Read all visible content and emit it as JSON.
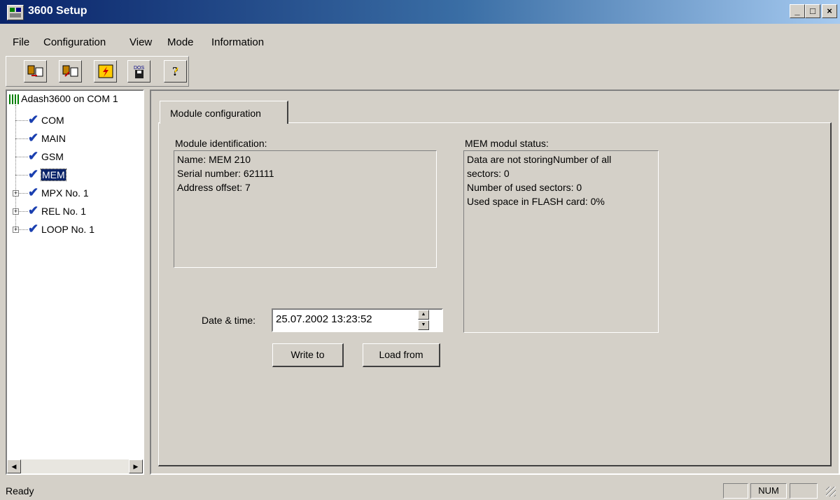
{
  "window": {
    "title": "3600 Setup",
    "min": "_",
    "max": "□",
    "close": "×"
  },
  "menu": [
    "File",
    "Configuration",
    "View",
    "Mode",
    "Information"
  ],
  "toolbar": [
    "connect-icon",
    "disconnect-icon",
    "flash-icon",
    "dos-disk-icon",
    "help-icon"
  ],
  "toolbar_dos_text": "DOS",
  "tree": {
    "root": "Adash3600 on COM 1",
    "items": [
      "COM",
      "MAIN",
      "GSM",
      "MEM",
      "MPX No. 1",
      "REL No. 1",
      "LOOP No. 1"
    ],
    "selected": "MEM"
  },
  "tab": {
    "label": "Module configuration"
  },
  "identification": {
    "label": "Module identification:",
    "lines": [
      "Name: MEM 210",
      "Serial number: 621111",
      "Address offset: 7"
    ]
  },
  "status": {
    "label": "MEM modul status:",
    "lines": [
      "Data are not storingNumber of all",
      "sectors: 0",
      "Number of used sectors: 0",
      "Used space in FLASH card: 0%"
    ]
  },
  "datetime": {
    "label": "Date & time:",
    "value": "25.07.2002  13:23:52"
  },
  "buttons": {
    "write": "Write to",
    "load": "Load from"
  },
  "statusbar": {
    "text": "Ready",
    "num": "NUM"
  }
}
